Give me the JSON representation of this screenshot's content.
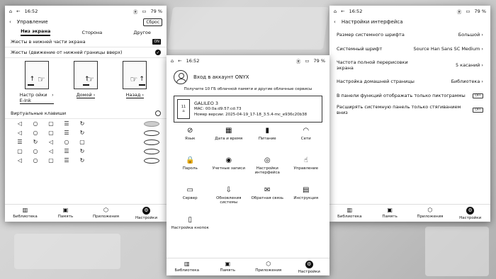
{
  "left": {
    "status": {
      "time": "16:52",
      "battery": "79 %"
    },
    "header": {
      "title": "Управление",
      "reset": "Сброс"
    },
    "tabs": [
      {
        "label": "Низ экрана",
        "active": true
      },
      {
        "label": "Сторона",
        "active": false
      },
      {
        "label": "Другое",
        "active": false
      }
    ],
    "gesture_row": {
      "label": "Жесты в нижней части экрана",
      "toggle": "ON"
    },
    "gesture_mode": "Жесты (движение от нижней границы вверх)",
    "gestures": [
      {
        "label": "Настр ойки E-Ink"
      },
      {
        "label": "Домой"
      },
      {
        "label": "Назад"
      }
    ],
    "virtual_keys": "Виртуальные клавиши",
    "nav": [
      {
        "label": "Библиотека",
        "icon": "library-icon"
      },
      {
        "label": "Память",
        "icon": "storage-icon"
      },
      {
        "label": "Приложения",
        "icon": "apps-icon"
      },
      {
        "label": "Настройки",
        "icon": "settings-icon",
        "active": true
      }
    ]
  },
  "mid": {
    "status": {
      "time": "16:52",
      "battery": "79 %"
    },
    "account": {
      "title": "Вход в аккаунт ONYX",
      "subtitle": "Получите 10 ГБ облачной памяти и другие облачные сервисы"
    },
    "device": {
      "screen_label": "11",
      "name": "GALILEO 3",
      "mac": "MAC: 00:0a:d9:57:cd:73",
      "version": "Номер версии: 2025-04-19_17-18_3.5.4-mc_e936c20b38"
    },
    "grid": [
      {
        "label": "Язык",
        "icon": "language-icon",
        "glyph": "⊘"
      },
      {
        "label": "Дата и время",
        "icon": "calendar-icon",
        "glyph": "▦"
      },
      {
        "label": "Питание",
        "icon": "battery-icon",
        "glyph": "▮"
      },
      {
        "label": "Сети",
        "icon": "wifi-icon",
        "glyph": "◠"
      },
      {
        "label": "Пароль",
        "icon": "lock-icon",
        "glyph": "🔒"
      },
      {
        "label": "Учетные записи",
        "icon": "account-icon",
        "glyph": "◉"
      },
      {
        "label": "Настройки интерфейса",
        "icon": "eye-icon",
        "glyph": "◎"
      },
      {
        "label": "Управление",
        "icon": "hand-icon",
        "glyph": "☝"
      },
      {
        "label": "Сервер",
        "icon": "server-icon",
        "glyph": "▭"
      },
      {
        "label": "Обновления системы",
        "icon": "update-icon",
        "glyph": "⇩"
      },
      {
        "label": "Обратная связь",
        "icon": "feedback-icon",
        "glyph": "✉"
      },
      {
        "label": "Инструкция",
        "icon": "manual-icon",
        "glyph": "▤"
      },
      {
        "label": "Настройка кнопок",
        "icon": "buttons-icon",
        "glyph": "▯"
      }
    ],
    "nav": [
      {
        "label": "Библиотека"
      },
      {
        "label": "Память"
      },
      {
        "label": "Приложения"
      },
      {
        "label": "Настройки",
        "active": true
      }
    ]
  },
  "right": {
    "status": {
      "time": "16:52",
      "battery": "79 %"
    },
    "header": {
      "title": "Настройки интерфейса"
    },
    "rows": [
      {
        "label": "Размер системного шрифта",
        "value": "Большой"
      },
      {
        "label": "Системный шрифт",
        "value": "Source Han Sans SC Medium"
      },
      {
        "label": "Частота полной перерисовки экрана",
        "value": "5 касаний"
      },
      {
        "label": "Настройка домашней страницы",
        "value": "Библиотека"
      }
    ],
    "switches": [
      {
        "label": "В панели функций отображать только пиктограммы",
        "state": "OFF"
      },
      {
        "label": "Расширять системную панель только стягиванием вниз",
        "state": "OFF"
      }
    ],
    "nav": [
      {
        "label": "Библиотека"
      },
      {
        "label": "Память"
      },
      {
        "label": "Приложения"
      },
      {
        "label": "Настройки",
        "active": true
      }
    ]
  }
}
